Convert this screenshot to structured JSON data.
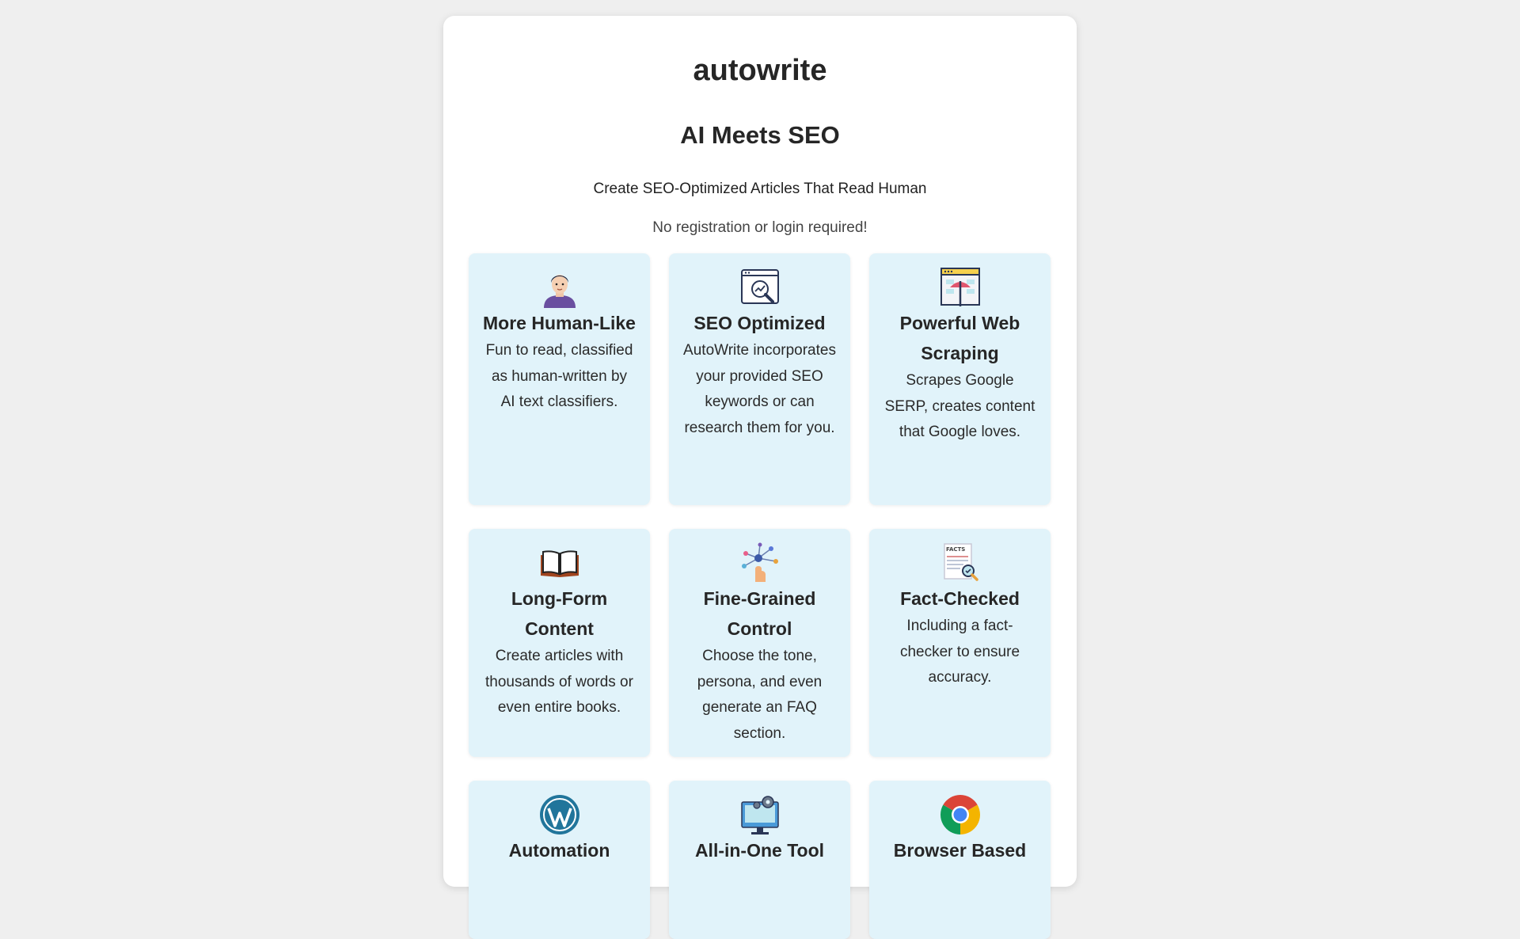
{
  "header": {
    "logo": "autowrite",
    "headline": "AI Meets SEO",
    "tagline": "Create SEO-Optimized Articles That Read Human",
    "note": "No registration or login required!"
  },
  "features": [
    {
      "icon": "person-icon",
      "title": "More Human-Like",
      "description": "Fun to read, classified as human-written by AI text classifiers."
    },
    {
      "icon": "seo-analysis-icon",
      "title": "SEO Optimized",
      "description": "AutoWrite incorporates your provided SEO keywords or can research them for you."
    },
    {
      "icon": "web-scraping-icon",
      "title": "Powerful Web Scraping",
      "description": "Scrapes Google SERP, creates content that Google loves."
    },
    {
      "icon": "open-book-icon",
      "title": "Long-Form Content",
      "description": "Create articles with thousands of words or even entire books."
    },
    {
      "icon": "control-network-icon",
      "title": "Fine-Grained Control",
      "description": "Choose the tone, persona, and even generate an FAQ section."
    },
    {
      "icon": "facts-check-icon",
      "title": "Fact-Checked",
      "description": "Including a fact-checker to ensure accuracy.",
      "icon_text": "FACTS"
    },
    {
      "icon": "wordpress-icon",
      "title": "Automation",
      "description": ""
    },
    {
      "icon": "monitor-gear-icon",
      "title": "All-in-One Tool",
      "description": ""
    },
    {
      "icon": "chrome-icon",
      "title": "Browser Based",
      "description": ""
    }
  ],
  "colors": {
    "page_background": "#efefef",
    "card_background": "#e1f3fa",
    "text": "#262626"
  }
}
